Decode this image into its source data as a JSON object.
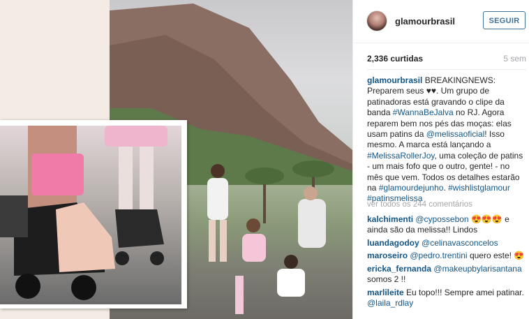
{
  "post": {
    "username": "glamourbrasil",
    "follow_label": "SEGUIR",
    "likes": "2,336 curtidas",
    "time_ago": "5 sem"
  },
  "caption": {
    "author": "glamourbrasil",
    "part1": " BREAKINGNEWS: Preparem seus ♥♥. Um grupo de patinadoras está gravando o clipe da banda ",
    "tag1": "#WannaBeJalva",
    "part2": " no RJ. Agora reparem bem nos pés das moças: elas usam patins da ",
    "mention1": "@melissaoficial",
    "part3": "! Isso mesmo. A marca está lançando a ",
    "tag2": "#MelissaRollerJoy",
    "part4": ", uma coleção de patins - um mais fofo que o outro, gente! - no mês que vem. Todos os detalhes estarão na ",
    "tag3": "#glamourdejunho",
    "part5": ". ",
    "tag4": "#wishlistglamour",
    "tag5": "#patinsmelissa"
  },
  "view_all_comments": "ver todos os 244 comentários",
  "comments": [
    {
      "user": "kalchimenti",
      "mention": "@cypossebon",
      "text": " 😍😍😍 e ainda são da melissa!! Lindos"
    },
    {
      "user": "luandagodoy",
      "mention": "@celinavasconcelos",
      "text": ""
    },
    {
      "user": "maroseiro",
      "mention": "@pedro.trentini",
      "text": " quero este! 😍"
    },
    {
      "user": "ericka_fernanda",
      "mention": "@makeupbylarisantana",
      "text": " somos 2 !!"
    },
    {
      "user": "marlileite",
      "text": " Eu topo!!! Sempre amei patinar. ",
      "mention": "@laila_rdlay"
    }
  ]
}
